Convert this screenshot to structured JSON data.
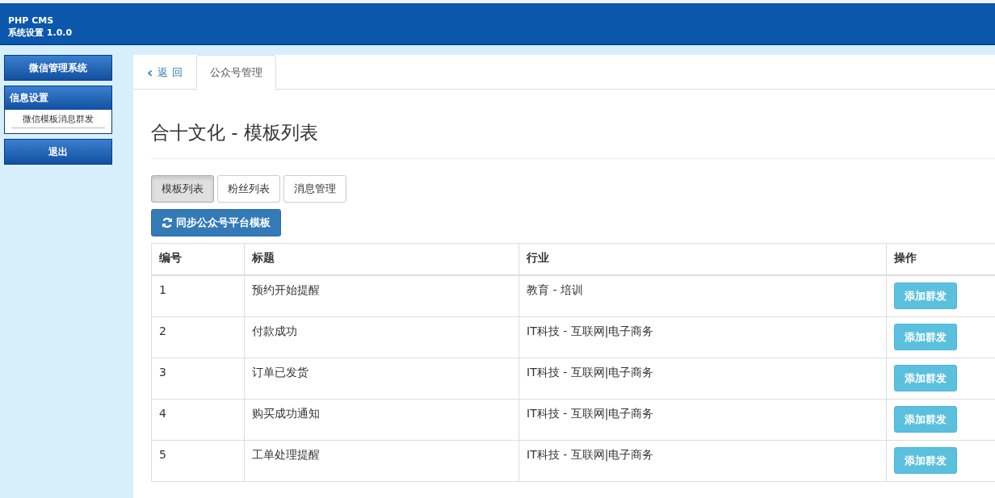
{
  "header": {
    "title": "PHP CMS",
    "subtitle": "系统设置 1.0.0"
  },
  "sidebar": [
    {
      "kind": "button",
      "label": "微信管理系统"
    },
    {
      "kind": "group",
      "label": "信息设置",
      "items": [
        {
          "label": "微信模板消息群发"
        }
      ]
    },
    {
      "kind": "button",
      "label": "退出"
    }
  ],
  "tabs": [
    {
      "kind": "back",
      "icon": "‹",
      "label": "返 回",
      "selected": false
    },
    {
      "kind": "tab",
      "label": "公众号管理",
      "selected": true
    }
  ],
  "page_title": "合十文化 - 模板列表",
  "sub_tabs": [
    {
      "label": "模板列表",
      "selected": true
    },
    {
      "label": "粉丝列表",
      "selected": false
    },
    {
      "label": "消息管理",
      "selected": false
    }
  ],
  "sync_button": "同步公众号平台模板",
  "table": {
    "columns": [
      "编号",
      "标题",
      "行业",
      "操作"
    ],
    "rows": [
      {
        "id": "1",
        "title": "预约开始提醒",
        "industry": "教育 - 培训",
        "action": "添加群发"
      },
      {
        "id": "2",
        "title": "付款成功",
        "industry": "IT科技 - 互联网|电子商务",
        "action": "添加群发"
      },
      {
        "id": "3",
        "title": "订单已发货",
        "industry": "IT科技 - 互联网|电子商务",
        "action": "添加群发"
      },
      {
        "id": "4",
        "title": "购买成功通知",
        "industry": "IT科技 - 互联网|电子商务",
        "action": "添加群发"
      },
      {
        "id": "5",
        "title": "工单处理提醒",
        "industry": "IT科技 - 互联网|电子商务",
        "action": "添加群发"
      }
    ]
  }
}
